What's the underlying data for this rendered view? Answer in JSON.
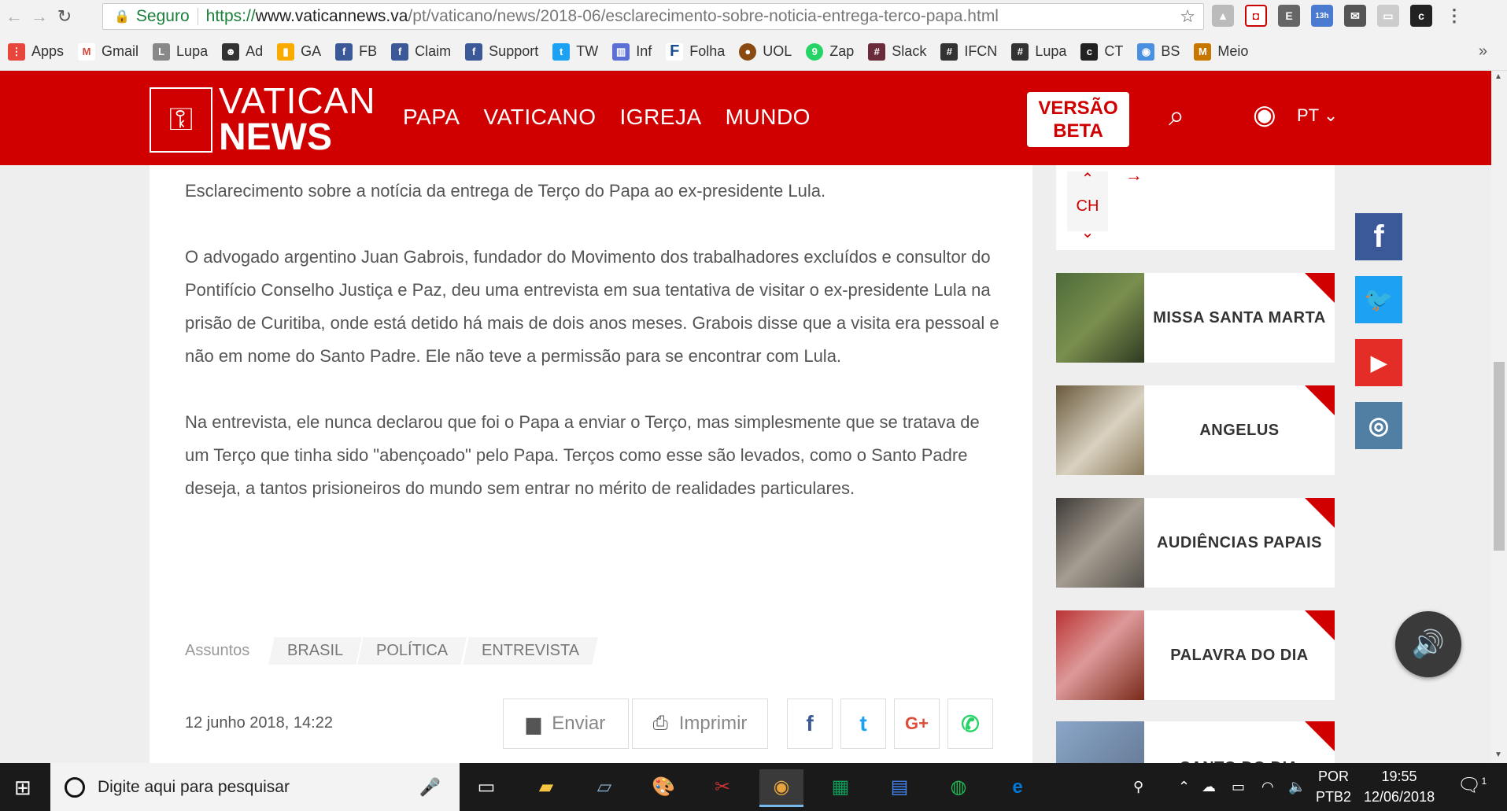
{
  "browser": {
    "secure_label": "Seguro",
    "url_scheme": "https://",
    "url_host": "www.vaticannews.va",
    "url_path": "/pt/vaticano/news/2018-06/esclarecimento-sobre-noticia-entrega-terco-papa.html",
    "ext_badge": "13h",
    "bookmarks": [
      "Apps",
      "Gmail",
      "Lupa",
      "Ad",
      "GA",
      "FB",
      "Claim",
      "Support",
      "TW",
      "Inf",
      "Folha",
      "UOL",
      "Zap",
      "Slack",
      "IFCN",
      "Lupa",
      "CT",
      "BS",
      "Meio"
    ],
    "more": "»"
  },
  "header": {
    "logo_line1": "VATICAN",
    "logo_line2": "NEWS",
    "nav": [
      "PAPA",
      "VATICANO",
      "IGREJA",
      "MUNDO"
    ],
    "beta_line1": "VERSÃO",
    "beta_line2": "BETA",
    "lang": "PT"
  },
  "article": {
    "paragraphs": [
      "Esclarecimento sobre a notícia da entrega de Terço do Papa ao ex-presidente Lula.",
      "O advogado argentino Juan Gabrois, fundador do Movimento dos trabalhadores excluídos e consultor do Pontifício Conselho Justiça e Paz, deu uma entrevista em sua tentativa de visitar o ex-presidente Lula na prisão de Curitiba, onde está detido há mais de dois anos meses. Grabois disse que a visita era pessoal e não em nome do Santo Padre. Ele não teve a permissão para se encontrar com Lula.",
      "Na entrevista, ele nunca declarou que foi o Papa a enviar o Terço, mas simplesmente que se tratava de um Terço que tinha sido \"abençoado\" pelo Papa. Terços como esse são levados, como o Santo Padre deseja, a tantos prisioneiros do mundo sem entrar no mérito de realidades particulares."
    ],
    "tags_label": "Assuntos",
    "tags": [
      "BRASIL",
      "POLÍTICA",
      "ENTREVISTA"
    ],
    "date": "12 junho 2018, 14:22",
    "send_label": "Enviar",
    "print_label": "Imprimir"
  },
  "sidebar": {
    "ch_label": "CH",
    "cards": [
      "MISSA SANTA MARTA",
      "ANGELUS",
      "AUDIÊNCIAS PAPAIS",
      "PALAVRA DO DIA",
      "SANTO DO DIA"
    ]
  },
  "taskbar": {
    "search_placeholder": "Digite aqui para pesquisar",
    "lang1": "POR",
    "lang2": "PTB2",
    "time": "19:55",
    "date": "12/06/2018",
    "notif_count": "1"
  }
}
